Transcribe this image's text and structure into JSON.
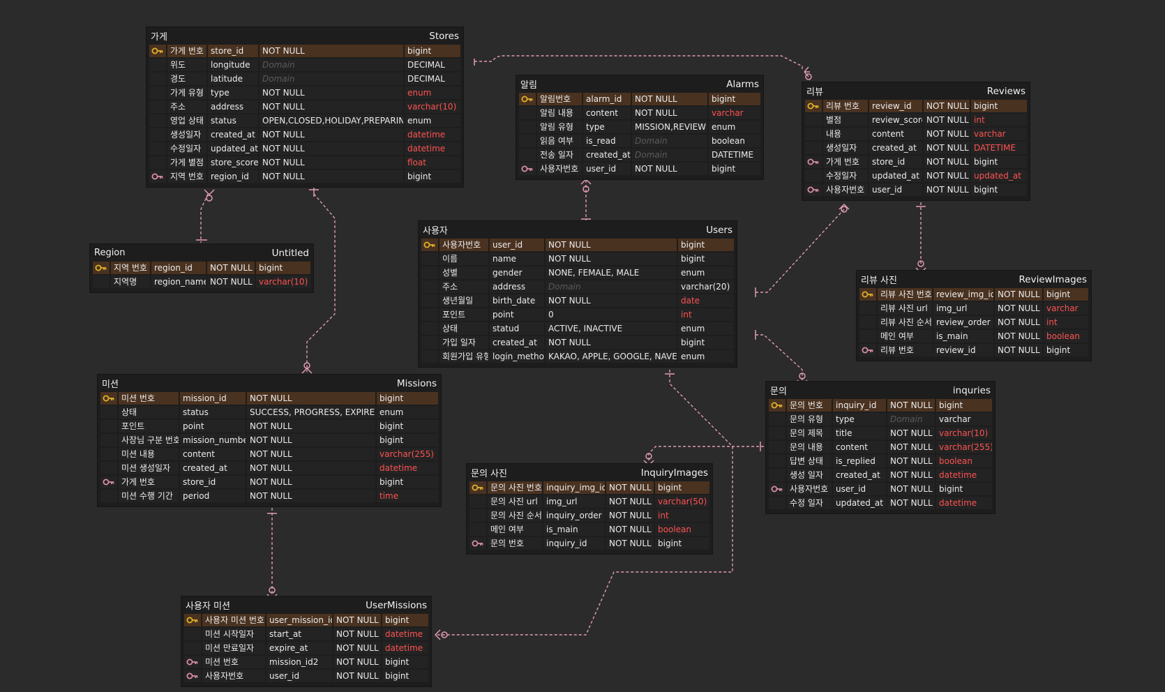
{
  "colors": {
    "background": "#2b2b2b",
    "table": "#1d1d1d",
    "pk_row": "#4a3220",
    "pk_key": "#e0b12a",
    "fk_key": "#d98ca5",
    "highlight_type": "#ff5252",
    "relation_line": "#e39bb3"
  },
  "tables": [
    {
      "id": "stores",
      "kr": "가게",
      "en": "Stores",
      "cols": [
        56,
        72,
        206,
        80
      ],
      "rows": [
        {
          "key": "pk",
          "kr": "가게 번호",
          "name": "store_id",
          "constraint": "NOT NULL",
          "type": "bigint"
        },
        {
          "key": "",
          "kr": "위도",
          "name": "longitude",
          "constraint": "Domain",
          "dom": true,
          "type": "DECIMAL"
        },
        {
          "key": "",
          "kr": "경도",
          "name": "latitude",
          "constraint": "Domain",
          "dom": true,
          "type": "DECIMAL"
        },
        {
          "key": "",
          "kr": "가게 유형",
          "name": "type",
          "constraint": "NOT NULL",
          "type": "enum",
          "red": true
        },
        {
          "key": "",
          "kr": "주소",
          "name": "address",
          "constraint": "NOT NULL",
          "type": "varchar(10)",
          "red": true
        },
        {
          "key": "",
          "kr": "영업 상태",
          "name": "status",
          "constraint": "OPEN,CLOSED,HOLIDAY,PREPARING",
          "type": "enum"
        },
        {
          "key": "",
          "kr": "생성일자",
          "name": "created_at",
          "constraint": "NOT NULL",
          "type": "datetime",
          "red": true
        },
        {
          "key": "",
          "kr": "수정일자",
          "name": "updated_at",
          "constraint": "NOT NULL",
          "type": "datetime",
          "red": true
        },
        {
          "key": "",
          "kr": "가게 별점",
          "name": "store_score",
          "constraint": "NOT NULL",
          "type": "float",
          "red": true
        },
        {
          "key": "fk",
          "kr": "지역 번호",
          "name": "region_id",
          "constraint": "NOT NULL",
          "type": "bigint"
        }
      ]
    },
    {
      "id": "region",
      "kr": "Region",
      "en": "Untitled",
      "cols": [
        56,
        78,
        68,
        78
      ],
      "rows": [
        {
          "key": "pk",
          "kr": "지역 번호",
          "name": "region_id",
          "constraint": "NOT NULL",
          "type": "bigint"
        },
        {
          "key": "",
          "kr": "지역명",
          "name": "region_name",
          "constraint": "NOT NULL",
          "type": "varchar(10)",
          "red": true
        }
      ]
    },
    {
      "id": "alarms",
      "kr": "알림",
      "en": "Alarms",
      "cols": [
        64,
        68,
        108,
        74
      ],
      "rows": [
        {
          "key": "pk",
          "kr": "알림번호",
          "name": "alarm_id",
          "constraint": "NOT NULL",
          "type": "bigint"
        },
        {
          "key": "",
          "kr": "알림 내용",
          "name": "content",
          "constraint": "NOT NULL",
          "type": "varchar",
          "red": true
        },
        {
          "key": "",
          "kr": "알림 유형",
          "name": "type",
          "constraint": "MISSION,REVIEW",
          "type": "enum"
        },
        {
          "key": "",
          "kr": "읽음 여부",
          "name": "is_read",
          "constraint": "Domain",
          "dom": true,
          "type": "boolean"
        },
        {
          "key": "",
          "kr": "전송 일자",
          "name": "created_at",
          "constraint": "Domain",
          "dom": true,
          "type": "DATETIME"
        },
        {
          "key": "fk",
          "kr": "사용자번호",
          "name": "user_id",
          "constraint": "NOT NULL",
          "type": "bigint"
        }
      ]
    },
    {
      "id": "reviews",
      "kr": "리뷰",
      "en": "Reviews",
      "cols": [
        64,
        76,
        66,
        80
      ],
      "rows": [
        {
          "key": "pk",
          "kr": "리뷰 번호",
          "name": "review_id",
          "constraint": "NOT NULL",
          "type": "bigint"
        },
        {
          "key": "",
          "kr": "별점",
          "name": "review_score",
          "constraint": "NOT NULL",
          "type": "int",
          "red": true
        },
        {
          "key": "",
          "kr": "내용",
          "name": "content",
          "constraint": "NOT NULL",
          "type": "varchar",
          "red": true
        },
        {
          "key": "",
          "kr": "생성일자",
          "name": "created_at",
          "constraint": "NOT NULL",
          "type": "DATETIME",
          "red": true
        },
        {
          "key": "fk",
          "kr": "가게 번호",
          "name": "store_id",
          "constraint": "NOT NULL",
          "type": "bigint"
        },
        {
          "key": "",
          "kr": "수정일자",
          "name": "updated_at",
          "constraint": "NOT NULL",
          "type": "updated_at",
          "red": true
        },
        {
          "key": "fk",
          "kr": "사용자번호",
          "name": "user_id",
          "constraint": "NOT NULL",
          "type": "bigint"
        }
      ]
    },
    {
      "id": "users",
      "kr": "사용자",
      "en": "Users",
      "cols": [
        70,
        78,
        188,
        80
      ],
      "rows": [
        {
          "key": "pk",
          "kr": "사용자번호",
          "name": "user_id",
          "constraint": "NOT NULL",
          "type": "bigint"
        },
        {
          "key": "",
          "kr": "이름",
          "name": "name",
          "constraint": "NOT NULL",
          "type": "bigint"
        },
        {
          "key": "",
          "kr": "성별",
          "name": "gender",
          "constraint": "NONE, FEMALE, MALE",
          "type": "enum"
        },
        {
          "key": "",
          "kr": "주소",
          "name": "address",
          "constraint": "Domain",
          "dom": true,
          "type": "varchar(20)"
        },
        {
          "key": "",
          "kr": "생년월일",
          "name": "birth_date",
          "constraint": "NOT NULL",
          "type": "date",
          "red": true
        },
        {
          "key": "",
          "kr": "포인트",
          "name": "point",
          "constraint": "0",
          "type": "int",
          "red": true
        },
        {
          "key": "",
          "kr": "상태",
          "name": "statud",
          "constraint": "ACTIVE, INACTIVE",
          "type": "enum"
        },
        {
          "key": "",
          "kr": "가입 일자",
          "name": "created_at",
          "constraint": "NOT NULL",
          "type": "bigint"
        },
        {
          "key": "",
          "kr": "회원가입 유형",
          "name": "login_method",
          "constraint": "KAKAO, APPLE, GOOGLE, NAVER",
          "type": "enum"
        }
      ]
    },
    {
      "id": "reviewimages",
      "kr": "리뷰 사진",
      "en": "ReviewImages",
      "cols": [
        78,
        86,
        68,
        64
      ],
      "rows": [
        {
          "key": "pk",
          "kr": "리뷰 사진 번호",
          "name": "review_img_id",
          "constraint": "NOT NULL",
          "type": "bigint"
        },
        {
          "key": "",
          "kr": "리뷰 사진 url",
          "name": "img_url",
          "constraint": "NOT NULL",
          "type": "varchar",
          "red": true
        },
        {
          "key": "",
          "kr": "리뷰 사진 순서",
          "name": "review_order",
          "constraint": "NOT NULL",
          "type": "int",
          "red": true
        },
        {
          "key": "",
          "kr": "메인 여부",
          "name": "is_main",
          "constraint": "NOT NULL",
          "type": "boolean",
          "red": true
        },
        {
          "key": "fk",
          "kr": "리뷰 번호",
          "name": "review_id",
          "constraint": "NOT NULL",
          "type": "bigint"
        }
      ]
    },
    {
      "id": "missions",
      "kr": "미션",
      "en": "Missions",
      "cols": [
        86,
        94,
        184,
        88
      ],
      "rows": [
        {
          "key": "pk",
          "kr": "미션 번호",
          "name": "mission_id",
          "constraint": "NOT NULL",
          "type": "bigint"
        },
        {
          "key": "",
          "kr": "상태",
          "name": "status",
          "constraint": "SUCCESS, PROGRESS, EXPIRED",
          "type": "enum"
        },
        {
          "key": "",
          "kr": "포인트",
          "name": "point",
          "constraint": "NOT NULL",
          "type": "bigint"
        },
        {
          "key": "",
          "kr": "사장님 구분 번호",
          "name": "mission_number",
          "constraint": "NOT NULL",
          "type": "bigint"
        },
        {
          "key": "",
          "kr": "미션 내용",
          "name": "content",
          "constraint": "NOT NULL",
          "type": "varchar(255)",
          "red": true
        },
        {
          "key": "",
          "kr": "미션 생성일자",
          "name": "created_at",
          "constraint": "NOT NULL",
          "type": "datetime",
          "red": true
        },
        {
          "key": "fk",
          "kr": "가게 번호",
          "name": "store_id",
          "constraint": "NOT NULL",
          "type": "bigint"
        },
        {
          "key": "",
          "kr": "미션 수행 기간",
          "name": "period",
          "constraint": "NOT NULL",
          "type": "time",
          "red": true
        }
      ]
    },
    {
      "id": "inquries",
      "kr": "문의",
      "en": "inquries",
      "cols": [
        64,
        76,
        68,
        80
      ],
      "rows": [
        {
          "key": "pk",
          "kr": "문의 번호",
          "name": "inquiry_id",
          "constraint": "NOT NULL",
          "type": "bigint"
        },
        {
          "key": "",
          "kr": "문의 유형",
          "name": "type",
          "constraint": "Domain",
          "dom": true,
          "type": "varchar"
        },
        {
          "key": "",
          "kr": "문의 제목",
          "name": "title",
          "constraint": "NOT NULL",
          "type": "varchar(10)",
          "red": true
        },
        {
          "key": "",
          "kr": "문의 내용",
          "name": "content",
          "constraint": "NOT NULL",
          "type": "varchar(255)",
          "red": true
        },
        {
          "key": "",
          "kr": "답변 상태",
          "name": "is_replied",
          "constraint": "NOT NULL",
          "type": "boolean",
          "red": true
        },
        {
          "key": "",
          "kr": "생성 일자",
          "name": "created_at",
          "constraint": "NOT NULL",
          "type": "datetime",
          "red": true
        },
        {
          "key": "fk",
          "kr": "사용자번호",
          "name": "user_id",
          "constraint": "NOT NULL",
          "type": "bigint"
        },
        {
          "key": "",
          "kr": "수정 일자",
          "name": "updated_at",
          "constraint": "NOT NULL",
          "type": "datetime",
          "red": true
        }
      ]
    },
    {
      "id": "inquiryimages",
      "kr": "문의 사진",
      "en": "InquiryImages",
      "cols": [
        78,
        88,
        68,
        78
      ],
      "rows": [
        {
          "key": "pk",
          "kr": "문의 사진 번호",
          "name": "inquiry_img_id",
          "constraint": "NOT NULL",
          "type": "bigint"
        },
        {
          "key": "",
          "kr": "문의 사진 url",
          "name": "img_url",
          "constraint": "NOT NULL",
          "type": "varchar(50)",
          "red": true
        },
        {
          "key": "",
          "kr": "문의 사진 순서",
          "name": "inquiry_order",
          "constraint": "NOT NULL",
          "type": "int",
          "red": true
        },
        {
          "key": "",
          "kr": "메인 여부",
          "name": "is_main",
          "constraint": "NOT NULL",
          "type": "boolean",
          "red": true
        },
        {
          "key": "fk",
          "kr": "문의 번호",
          "name": "inquiry_id",
          "constraint": "NOT NULL",
          "type": "bigint"
        }
      ]
    },
    {
      "id": "usermissions",
      "kr": "사용자 미션",
      "en": "UserMissions",
      "cols": [
        90,
        94,
        68,
        66
      ],
      "rows": [
        {
          "key": "pk",
          "kr": "사용자 미션 번호",
          "name": "user_mission_id",
          "constraint": "NOT NULL",
          "type": "bigint"
        },
        {
          "key": "",
          "kr": "미션 시작일자",
          "name": "start_at",
          "constraint": "NOT NULL",
          "type": "datetime",
          "red": true
        },
        {
          "key": "",
          "kr": "미션 만료일자",
          "name": "expire_at",
          "constraint": "NOT NULL",
          "type": "datetime",
          "red": true
        },
        {
          "key": "fk",
          "kr": "미션 번호",
          "name": "mission_id2",
          "constraint": "NOT NULL",
          "type": "bigint"
        },
        {
          "key": "fk",
          "kr": "사용자번호",
          "name": "user_id",
          "constraint": "NOT NULL",
          "type": "bigint"
        }
      ]
    }
  ]
}
